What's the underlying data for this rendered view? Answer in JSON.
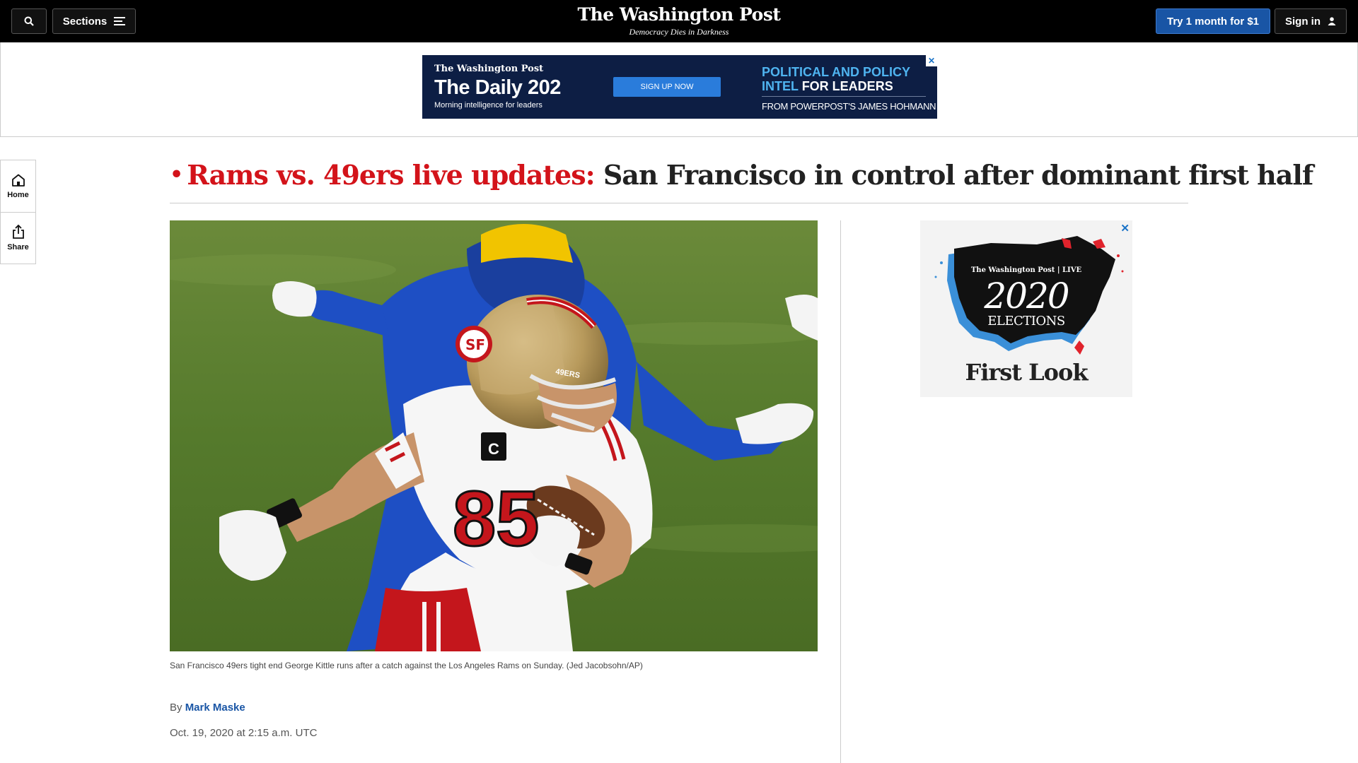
{
  "topbar": {
    "search_icon": "search-icon",
    "sections_label": "Sections",
    "logo": "The Washington Post",
    "tagline": "Democracy Dies in Darkness",
    "subscribe_label": "Try 1 month for $1",
    "signin_label": "Sign in"
  },
  "top_ad": {
    "logo": "The Washington Post",
    "title": "The Daily 202",
    "subtitle": "Morning intelligence for leaders",
    "cta": "SIGN UP NOW",
    "pitch_line1": "POLITICAL AND POLICY",
    "pitch_line2_blue": "INTEL",
    "pitch_line2_white": "FOR LEADERS",
    "from": "FROM POWERPOST'S JAMES HOHMANN",
    "close": "✕"
  },
  "rail": {
    "home_label": "Home",
    "share_label": "Share"
  },
  "article": {
    "kicker": "Rams vs. 49ers live updates:",
    "headline": "San Francisco in control after dominant first half",
    "caption": "San Francisco 49ers tight end George Kittle runs after a catch against the Los Angeles Rams on Sunday. (Jed Jacobsohn/AP)",
    "by": "By",
    "author": "Mark Maske",
    "date": "Oct. 19, 2020 at 2:15 a.m. UTC",
    "jersey_number": "85",
    "helmet_text": "49ERS",
    "captain_patch": "C"
  },
  "side_ad": {
    "brand": "The Washington Post | LIVE",
    "year": "2020",
    "elections": "ELECTIONS",
    "tagline": "First Look",
    "close": "✕"
  },
  "colors": {
    "accent_red": "#d3131a",
    "link_blue": "#1955a5",
    "ad_navy": "#0d1e44"
  }
}
